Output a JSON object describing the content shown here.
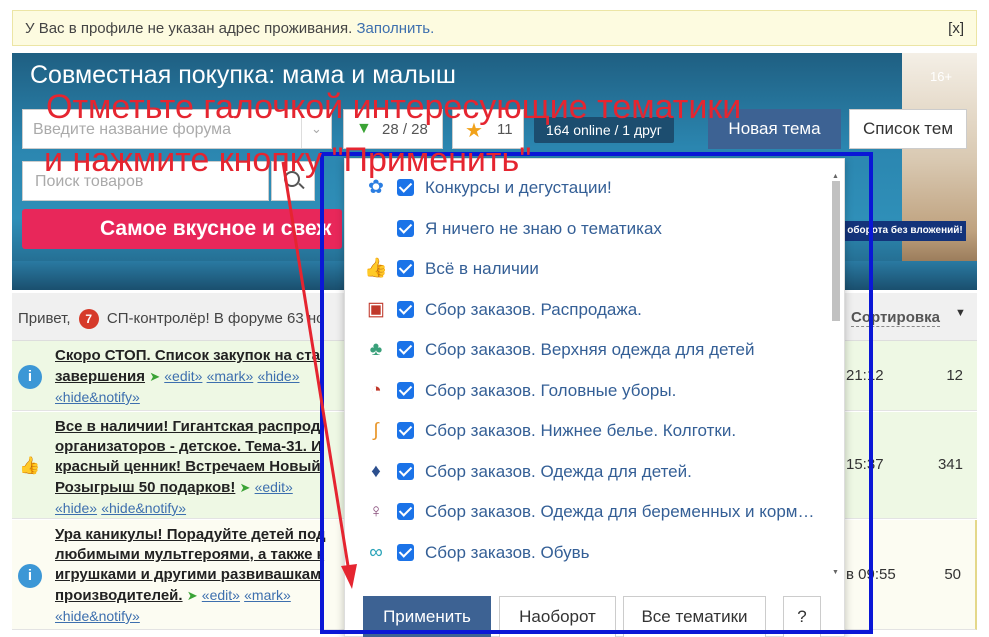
{
  "notice": {
    "text": "У Вас в профиле не указан адрес проживания.",
    "link": "Заполнить.",
    "close": "[x]"
  },
  "banner": {
    "title": "Совместная покупка: мама и малыш",
    "age": "16+",
    "forum_placeholder": "Введите название форума",
    "filter_count": "28 / 28",
    "star_count": "11",
    "online": "164 online  / 1 друг",
    "new_topic": "Новая тема",
    "topic_list": "Список тем",
    "search_placeholder": "Поиск товаров",
    "promo": "Самое вкусное и свеж",
    "promo2": "оборота без вложений!"
  },
  "instruction": {
    "line1": "Отметьте галочкой интересующие тематики",
    "line2": "и нажмите кнопку \"Применить\""
  },
  "forum": {
    "greeting": "Привет,",
    "greeting_rest": "СП-контролёр! В форуме 63 но",
    "greeting_badge": "7",
    "sort": "Сортировка",
    "rows": [
      {
        "l1": "Скоро СТОП. Список закупок на ста",
        "l2": "завершения",
        "tags2": [
          "«edit»",
          "«mark»",
          "«hide»"
        ],
        "tags3": [
          "«hide&notify»"
        ],
        "time": "21:12",
        "count": "12"
      },
      {
        "l1": "Все в наличии! Гигантская распрод",
        "l2": "организаторов - детское. Тема-31. И",
        "l3": "красный ценник! Встречаем Новый",
        "l4": "Розыгрыш 50 подарков!",
        "tags4": [
          "«edit»"
        ],
        "tags5": [
          "«hide»",
          "«hide&notify»"
        ],
        "time": "15:37",
        "count": "341"
      },
      {
        "l1": "Ура каникулы! Порадуйте детей под",
        "l2": "любимыми мультгероями, а также к",
        "l3": "игрушками и другими развивашкам",
        "l4": "производителей.",
        "tags4": [
          "«edit»",
          "«mark»"
        ],
        "tags5": [
          "«hide&notify»"
        ],
        "time": "в 09:55",
        "count": "50"
      }
    ]
  },
  "dropdown": {
    "items": [
      {
        "icon": "pinwheel-icon",
        "glyph": "✿",
        "color": "#2a7de1",
        "label": "Конкурсы и дегустации!"
      },
      {
        "icon": "",
        "glyph": "",
        "color": "",
        "label": "Я ничего не знаю о тематиках"
      },
      {
        "icon": "thumbs-up-icon",
        "glyph": "👍",
        "color": "#e0a24a",
        "label": "Всё в наличии"
      },
      {
        "icon": "sale-tag-icon",
        "glyph": "▣",
        "color": "#c0392b",
        "label": "Сбор заказов. Распродажа."
      },
      {
        "icon": "outerwear-icon",
        "glyph": "♣",
        "color": "#3aa07a",
        "label": "Сбор заказов. Верхняя одежда для детей"
      },
      {
        "icon": "hat-icon",
        "glyph": "◔",
        "color": "#c0392b",
        "label": "Сбор заказов. Головные уборы."
      },
      {
        "icon": "tights-icon",
        "glyph": "∫",
        "color": "#e8962a",
        "label": "Сбор заказов. Нижнее белье. Колготки."
      },
      {
        "icon": "kids-clothes-icon",
        "glyph": "♦",
        "color": "#2c4f8e",
        "label": "Сбор заказов. Одежда для детей."
      },
      {
        "icon": "maternity-icon",
        "glyph": "♀",
        "color": "#8a4f7d",
        "label": "Сбор заказов. Одежда для беременных и кормящих"
      },
      {
        "icon": "shoes-icon",
        "glyph": "∞",
        "color": "#2aa3b8",
        "label": "Сбор заказов. Обувь"
      }
    ],
    "apply": "Применить",
    "invert": "Наоборот",
    "all": "Все тематики",
    "help": "?"
  }
}
